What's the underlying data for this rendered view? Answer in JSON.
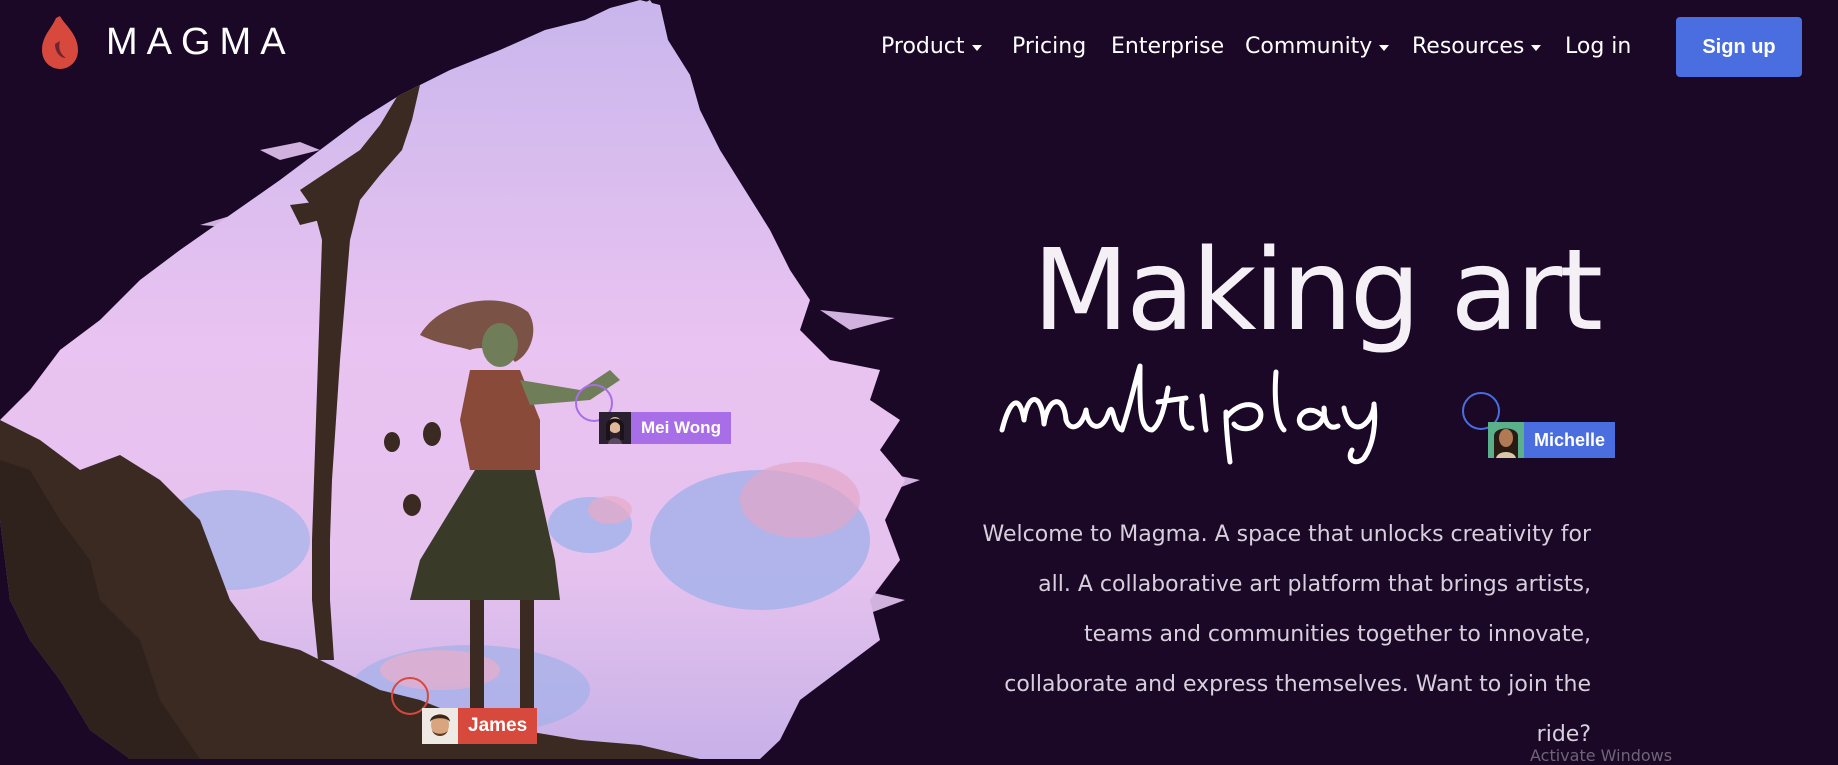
{
  "brand": {
    "name": "MAGMA",
    "color": "#d6493c"
  },
  "nav": {
    "items": [
      {
        "label": "Product",
        "dropdown": true
      },
      {
        "label": "Pricing",
        "dropdown": false
      },
      {
        "label": "Enterprise",
        "dropdown": false
      },
      {
        "label": "Community",
        "dropdown": true
      },
      {
        "label": "Resources",
        "dropdown": true
      },
      {
        "label": "Log in",
        "dropdown": false
      }
    ],
    "signup_label": "Sign up",
    "signup_color": "#4a6ee0"
  },
  "hero": {
    "title": "Making art",
    "script_word": "multiplay",
    "body": "Welcome to Magma. A space that unlocks creativity for all. A collaborative art platform that brings artists, teams and communities together to innovate, collaborate and express themselves. Want to join the ride?"
  },
  "cursors": [
    {
      "name": "Mei Wong",
      "color": "#a86ee8"
    },
    {
      "name": "Michelle",
      "color": "#4a6ee0"
    },
    {
      "name": "James",
      "color": "#d6493c"
    }
  ],
  "overlay": {
    "watermark": "Activate Windows"
  },
  "colors": {
    "background": "#1a0826",
    "sky": "#e6c4f2",
    "silhouette": "#3a2a22"
  }
}
